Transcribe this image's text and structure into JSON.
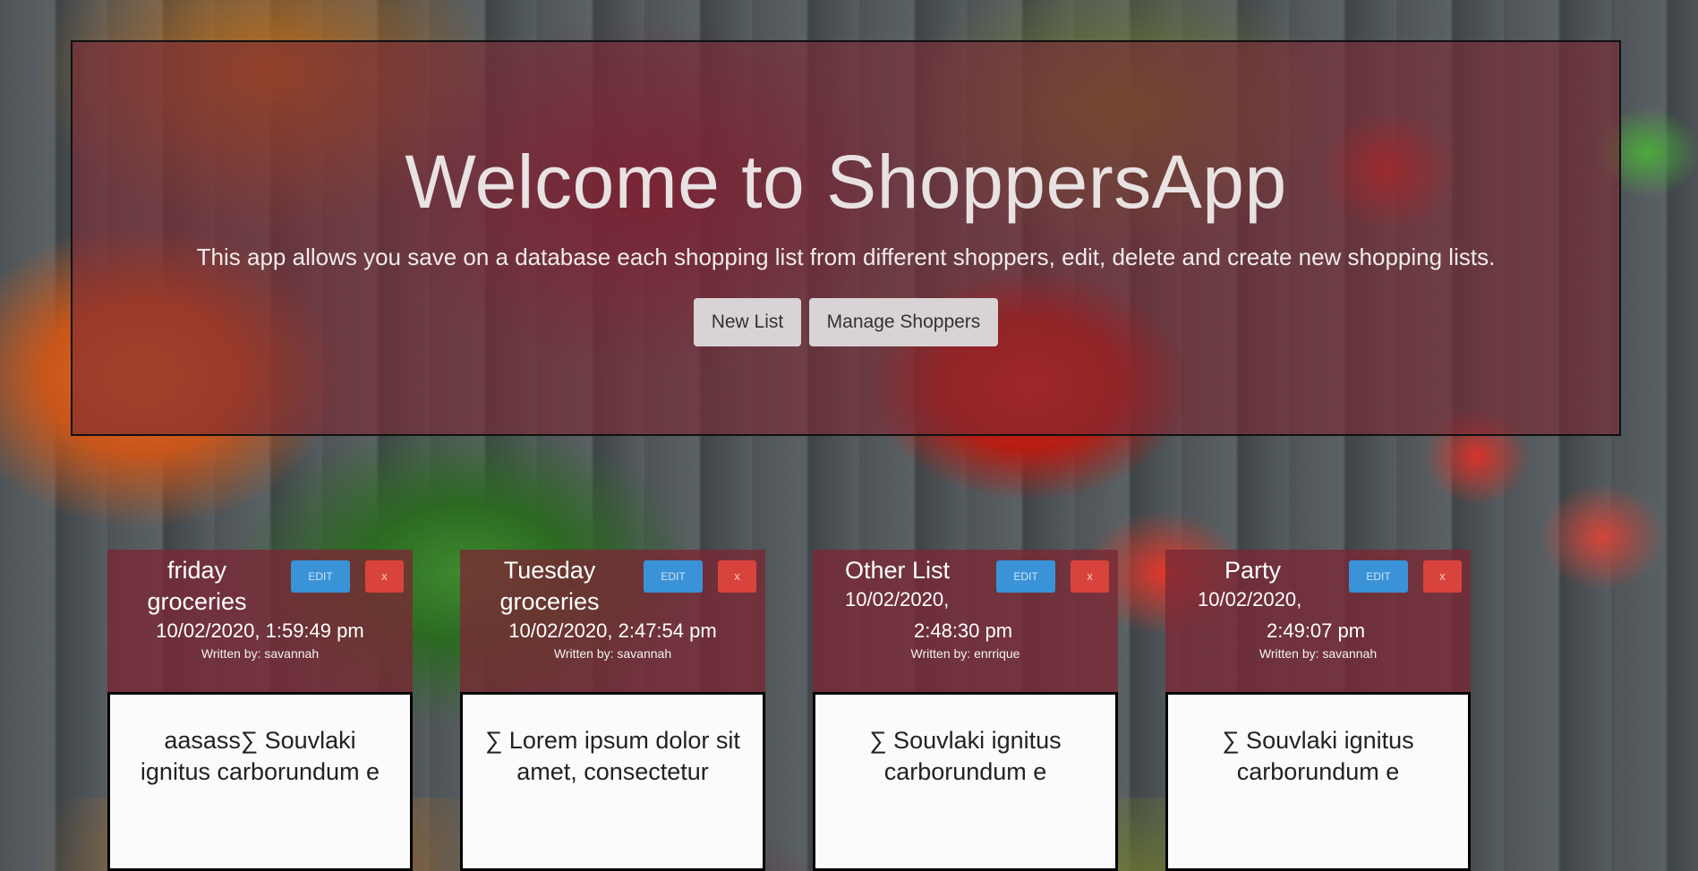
{
  "hero": {
    "title": "Welcome to ShoppersApp",
    "subtitle": "This app allows you save on a database each shopping list from different shoppers, edit, delete and create new shopping lists.",
    "new_list_label": "New List",
    "manage_shoppers_label": "Manage Shoppers"
  },
  "colors": {
    "panel": "#7a2834",
    "edit_button": "#3a93d6",
    "delete_button": "#d8443c"
  },
  "cards": [
    {
      "title": "friday groceries",
      "date": "10/02/2020, 1:59:49 pm",
      "author": "Written by: savannah",
      "edit_label": "EDIT",
      "delete_label": "x",
      "body": "aasass∑ Souvlaki ignitus carborundum e"
    },
    {
      "title": "Tuesday groceries",
      "date": "10/02/2020, 2:47:54 pm",
      "author": "Written by: savannah",
      "edit_label": "EDIT",
      "delete_label": "x",
      "body": "∑ Lorem ipsum dolor sit amet, consectetur"
    },
    {
      "title": "Other List",
      "date": "10/02/2020,",
      "date2": "2:48:30 pm",
      "author": "Written by: enrrique",
      "edit_label": "EDIT",
      "delete_label": "x",
      "body": "∑ Souvlaki ignitus carborundum e"
    },
    {
      "title": "Party",
      "date": "10/02/2020,",
      "date2": "2:49:07 pm",
      "author": "Written by: savannah",
      "edit_label": "EDIT",
      "delete_label": "x",
      "body": "∑ Souvlaki ignitus carborundum e"
    }
  ]
}
